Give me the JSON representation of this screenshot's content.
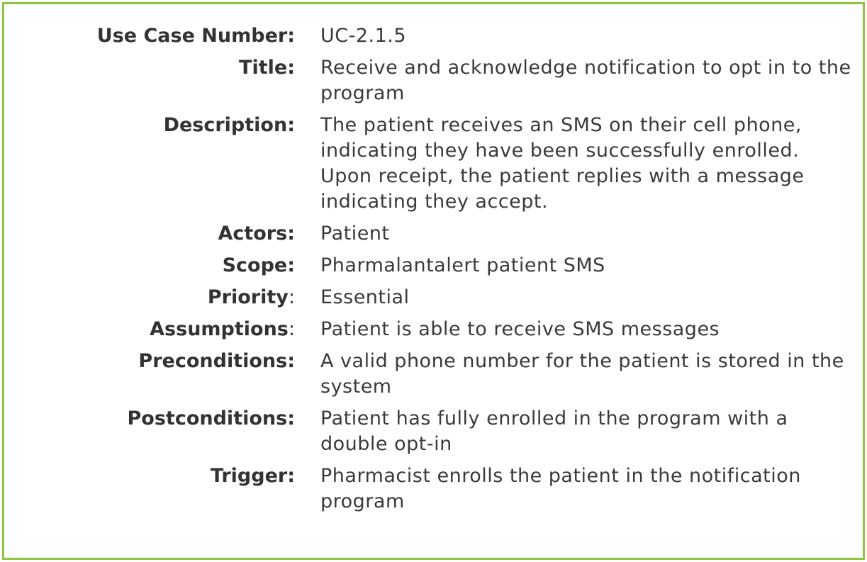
{
  "border_color": "#8cc63f",
  "text_color": "#333333",
  "rows": [
    {
      "label": "Use Case Number:",
      "value": "UC-2.1.5"
    },
    {
      "label": "Title:",
      "value": "Receive and acknowledge notification to opt in to the program"
    },
    {
      "label": "Description:",
      "value": "The patient receives an SMS on their cell phone, indicating they have been successfully enrolled. Upon receipt, the patient replies with a message indicating they accept."
    },
    {
      "label": "Actors:",
      "value": "Patient"
    },
    {
      "label": "Scope:",
      "value": "Pharmalantalert patient SMS"
    },
    {
      "label_main": "Priority",
      "label_colon": ":",
      "value": "Essential"
    },
    {
      "label_main": "Assumptions",
      "label_colon": ":",
      "value": "Patient is able to receive SMS messages"
    },
    {
      "label": "Preconditions:",
      "value": "A valid phone number for the patient is stored in the system"
    },
    {
      "label": "Postconditions:",
      "value": "Patient has fully enrolled in the program with a double opt-in"
    },
    {
      "label": "Trigger:",
      "value": "Pharmacist enrolls the patient in the notification program"
    }
  ]
}
